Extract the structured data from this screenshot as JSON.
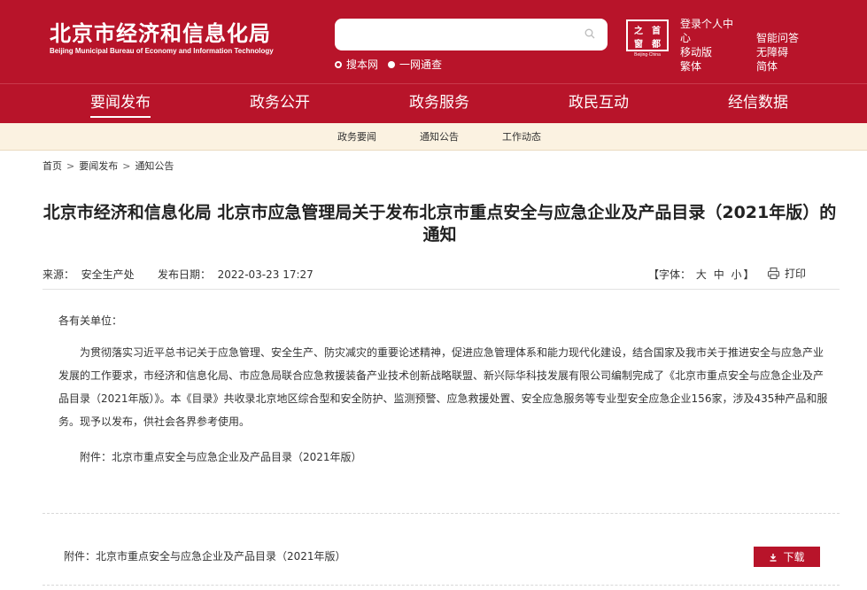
{
  "header": {
    "title": "北京市经济和信息化局",
    "subtitle": "Beijing Municipal Bureau of Economy and Information Technology",
    "search_placeholder": "",
    "scope_site": "搜本网",
    "scope_all": "一网通查",
    "seal_chars": [
      "之",
      "首",
      "都",
      "窗"
    ],
    "seal_caption": "Beijing·China",
    "links": {
      "login": "登录个人中",
      "login_2": "心",
      "mobile": "移动版",
      "traditional": "繁体",
      "qa": "智能问答",
      "accessible": "无障碍",
      "simplified": "简体"
    },
    "bg_color": "#b8142a"
  },
  "nav": {
    "items": [
      "要闻发布",
      "政务公开",
      "政务服务",
      "政民互动",
      "经信数据"
    ],
    "active": "要闻发布"
  },
  "subnav": {
    "items": [
      "政务要闻",
      "通知公告",
      "工作动态"
    ]
  },
  "breadcrumb": {
    "items": [
      "首页",
      "要闻发布",
      "通知公告"
    ],
    "separator": ">"
  },
  "article": {
    "title": "北京市经济和信息化局 北京市应急管理局关于发布北京市重点安全与应急企业及产品目录（2021年版）的通知",
    "source_label": "来源：",
    "source": "安全生产处",
    "date_label": "发布日期：",
    "date": "2022-03-23 17:27",
    "font_label_open": "【字体：",
    "font_large": "大",
    "font_medium": "中",
    "font_small": "小",
    "font_label_close": "】",
    "print_label": "打印",
    "salutation": "各有关单位：",
    "paragraph": "为贯彻落实习近平总书记关于应急管理、安全生产、防灾减灾的重要论述精神，促进应急管理体系和能力现代化建设，结合国家及我市关于推进安全与应急产业发展的工作要求，市经济和信息化局、市应急局联合应急救援装备产业技术创新战略联盟、新兴际华科技发展有限公司编制完成了《北京市重点安全与应急企业及产品目录（2021年版）》。本《目录》共收录北京地区综合型和安全防护、监测预警、应急救援处置、安全应急服务等专业型安全应急企业156家，涉及435种产品和服务。现予以发布，供社会各界参考使用。",
    "attachment_inline": "附件：北京市重点安全与应急企业及产品目录（2021年版）"
  },
  "attachments": {
    "label": "附件：北京市重点安全与应急企业及产品目录（2021年版）",
    "download_label": "下载"
  }
}
